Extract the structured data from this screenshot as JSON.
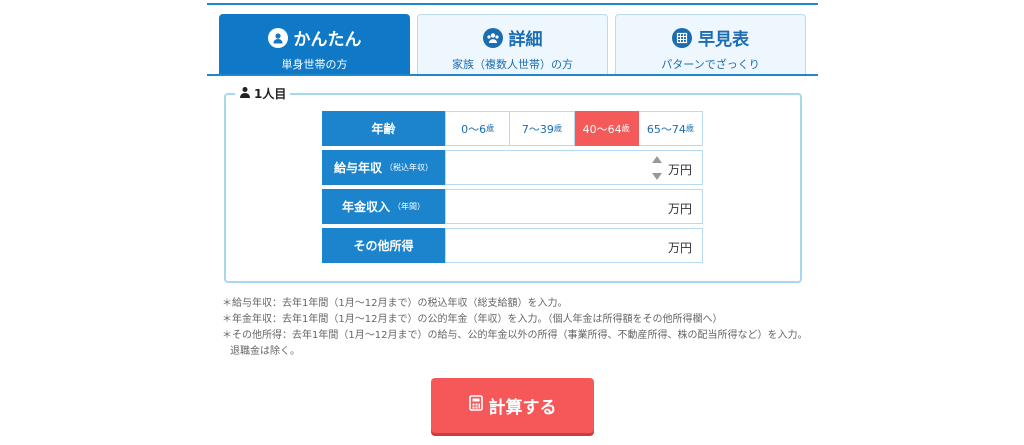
{
  "tabs": [
    {
      "title": "かんたん",
      "sub": "単身世帯の方",
      "icon": "user-icon",
      "active": true
    },
    {
      "title": "詳細",
      "sub": "家族（複数人世帯）の方",
      "icon": "group-icon",
      "active": false
    },
    {
      "title": "早見表",
      "sub": "パターンでざっくり",
      "icon": "table-icon",
      "active": false
    }
  ],
  "panel": {
    "legend": "1人目"
  },
  "age": {
    "label": "年齢",
    "options": [
      {
        "text": "0～6",
        "suffix": "歳"
      },
      {
        "text": "7～39",
        "suffix": "歳"
      },
      {
        "text": "40～64",
        "suffix": "歳"
      },
      {
        "text": "65～74",
        "suffix": "歳"
      }
    ],
    "selected_index": 2
  },
  "salary": {
    "label": "給与年収",
    "note": "（税込年収）",
    "unit": "万円"
  },
  "pension": {
    "label": "年金収入",
    "note": "（年間）",
    "unit": "万円"
  },
  "other": {
    "label": "その他所得",
    "unit": "万円"
  },
  "notes": [
    "＊給与年収：去年1年間（1月～12月まで）の税込年収（総支給額）を入力。",
    "＊年金年収：去年1年間（1月～12月まで）の公的年金（年収）を入力。（個人年金は所得額をその他所得欄へ）",
    "＊その他所得：去年1年間（1月～12月まで）の給与、公的年金以外の所得（事業所得、不動産所得、株の配当所得など）を入力。退職金は除く。"
  ],
  "calc_button": "計算する",
  "colors": {
    "primary": "#1079c7",
    "selected": "#f55a5a",
    "button": "#f65758"
  }
}
